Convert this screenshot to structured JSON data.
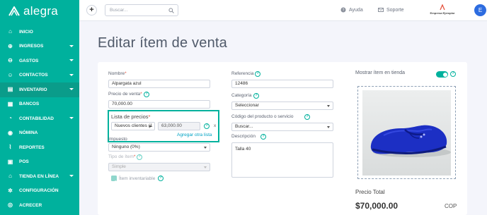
{
  "brand": {
    "name": "alegra",
    "color": "#00b19d"
  },
  "sidebar": {
    "items": [
      {
        "label": "INICIO",
        "icon": "home-icon",
        "caret": false
      },
      {
        "label": "INGRESOS",
        "icon": "income-icon",
        "caret": true
      },
      {
        "label": "GASTOS",
        "icon": "expenses-icon",
        "caret": true
      },
      {
        "label": "CONTACTOS",
        "icon": "contacts-icon",
        "caret": true
      },
      {
        "label": "INVENTARIO",
        "icon": "inventory-icon",
        "caret": true,
        "active": true
      },
      {
        "label": "BANCOS",
        "icon": "bank-icon",
        "caret": false
      },
      {
        "label": "CONTABILIDAD",
        "icon": "accounting-icon",
        "caret": true
      },
      {
        "label": "NÓMINA",
        "icon": "payroll-icon",
        "caret": false
      },
      {
        "label": "REPORTES",
        "icon": "reports-icon",
        "caret": false
      },
      {
        "label": "POS",
        "icon": "pos-icon",
        "caret": false
      },
      {
        "label": "TIENDA EN LÍNEA",
        "icon": "store-icon",
        "caret": true
      },
      {
        "label": "CONFIGURACIÓN",
        "icon": "settings-icon",
        "caret": false
      },
      {
        "label": "ACRECER",
        "icon": "acrecer-icon",
        "caret": false
      }
    ]
  },
  "topbar": {
    "search_placeholder": "Buscar...",
    "help_label": "Ayuda",
    "support_label": "Soporte",
    "company_name": "Empresa Ejemplar",
    "avatar_initial": "E"
  },
  "page": {
    "title": "Editar ítem de venta"
  },
  "form": {
    "name": {
      "label": "Nombre",
      "value": "Alpargata azul"
    },
    "sale_price": {
      "label": "Precio de venta",
      "value": "70,000.00"
    },
    "price_list": {
      "label": "Lista de precios",
      "selected": "Nuevos clientes (1",
      "value": "63,000.00",
      "remove": "x",
      "add_link": "Agregar otra lista"
    },
    "tax": {
      "label": "Impuesto",
      "value": "Ninguno (0%)"
    },
    "item_type": {
      "label": "Tipo de ítem",
      "value": "Simple"
    },
    "inventoriable": {
      "label": "Ítem inventariable",
      "checked": true
    },
    "reference": {
      "label": "Referencia",
      "value": "12486"
    },
    "category": {
      "label": "Categoría",
      "value": "Seleccionar"
    },
    "product_code": {
      "label": "Código del producto o servicio",
      "value": "Buscar..."
    },
    "description": {
      "label": "Descripción",
      "value": "Talla 40"
    }
  },
  "store": {
    "label": "Mostrar ítem en tienda",
    "enabled": true
  },
  "total": {
    "label": "Precio Total",
    "value": "$70,000.00",
    "currency": "COP"
  }
}
